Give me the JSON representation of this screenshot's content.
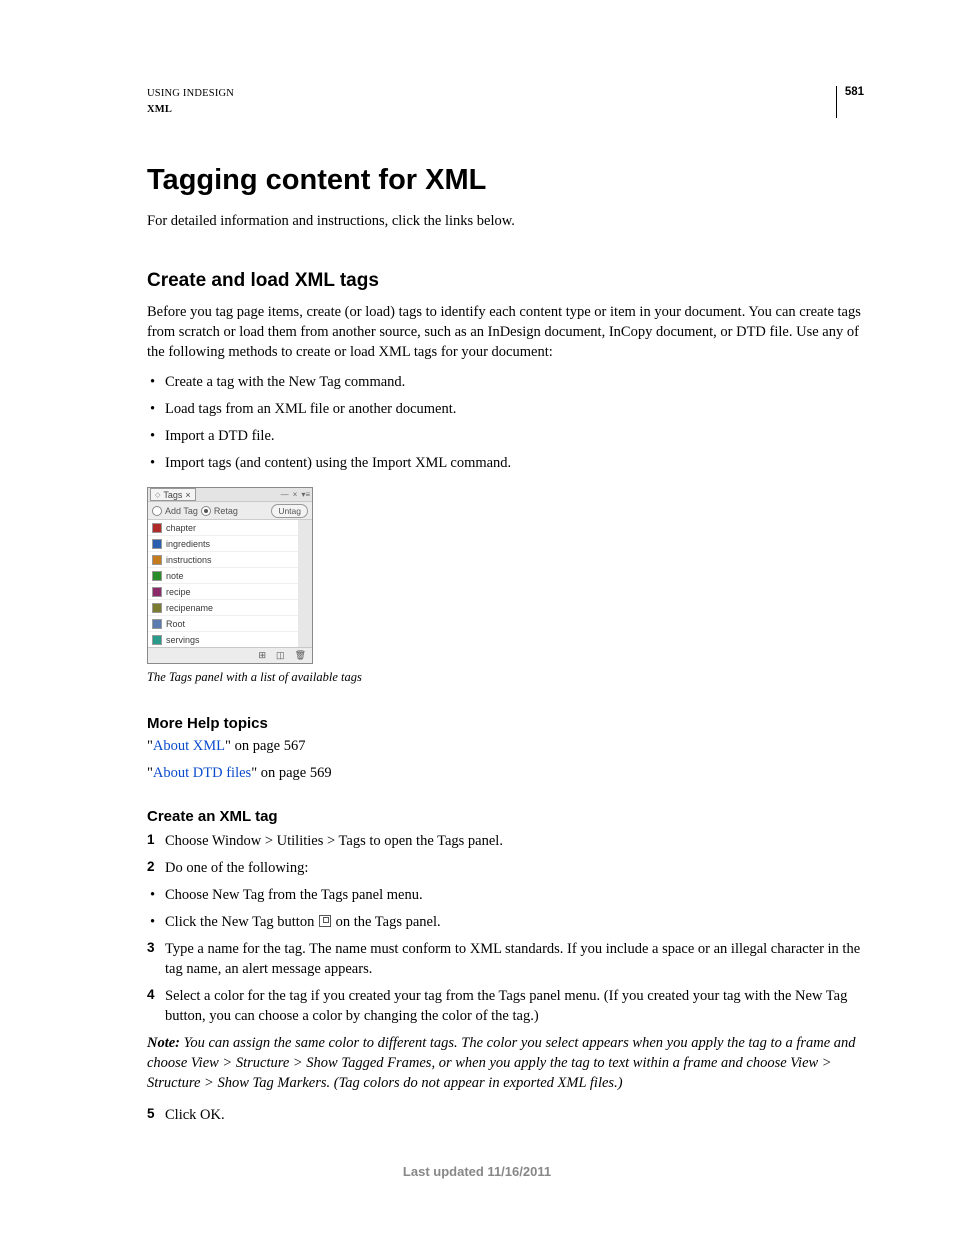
{
  "header": {
    "product": "USING INDESIGN",
    "section": "XML",
    "page_number": "581"
  },
  "title": "Tagging content for XML",
  "intro": "For detailed information and instructions, click the links below.",
  "section1": {
    "heading": "Create and load XML tags",
    "para": "Before you tag page items, create (or load) tags to identify each content type or item in your document. You can create tags from scratch or load them from another source, such as an InDesign document, InCopy document, or DTD file. Use any of the following methods to create or load XML tags for your document:",
    "bullets": [
      "Create a tag with the New Tag command.",
      "Load tags from an XML file or another document.",
      "Import a DTD file.",
      "Import tags (and content) using the Import XML command."
    ]
  },
  "tags_panel": {
    "tab_label": "Tags",
    "add_tag": "Add Tag",
    "retag": "Retag",
    "untag": "Untag",
    "items": [
      {
        "name": "chapter",
        "color": "#b02a2a"
      },
      {
        "name": "ingredients",
        "color": "#2a5fb0"
      },
      {
        "name": "instructions",
        "color": "#c47a1e"
      },
      {
        "name": "note",
        "color": "#2a8b2a"
      },
      {
        "name": "recipe",
        "color": "#8b2a6b"
      },
      {
        "name": "recipename",
        "color": "#7a7a30"
      },
      {
        "name": "Root",
        "color": "#5a7ab0"
      },
      {
        "name": "servings",
        "color": "#2a9a8a"
      }
    ]
  },
  "caption": "The Tags panel with a list of available tags",
  "more_help": {
    "heading": "More Help topics",
    "links": [
      {
        "text": "About XML",
        "suffix": "\" on page 567"
      },
      {
        "text": "About DTD files",
        "suffix": "\" on page 569"
      }
    ],
    "quote": "\""
  },
  "section2": {
    "heading": "Create an XML tag",
    "steps": {
      "s1": "Choose Window > Utilities > Tags to open the Tags panel.",
      "s2": "Do one of the following:",
      "s2a": "Choose New Tag from the Tags panel menu.",
      "s2b_pre": "Click the New Tag button ",
      "s2b_post": " on the Tags panel.",
      "s3": "Type a name for the tag. The name must conform to XML standards. If you include a space or an illegal character in the tag name, an alert message appears.",
      "s4": "Select a color for the tag if you created your tag from the Tags panel menu. (If you created your tag with the New Tag button, you can choose a color by changing the color of the tag.)",
      "note_label": "Note:",
      "note_body": " You can assign the same color to different tags. The color you select appears when you apply the tag to a frame and choose View > Structure > Show Tagged Frames, or when you apply the tag to text within a frame and choose View > Structure > Show Tag Markers. (Tag colors do not appear in exported XML files.)",
      "s5": "Click OK."
    }
  },
  "footer_date": "Last updated 11/16/2011"
}
